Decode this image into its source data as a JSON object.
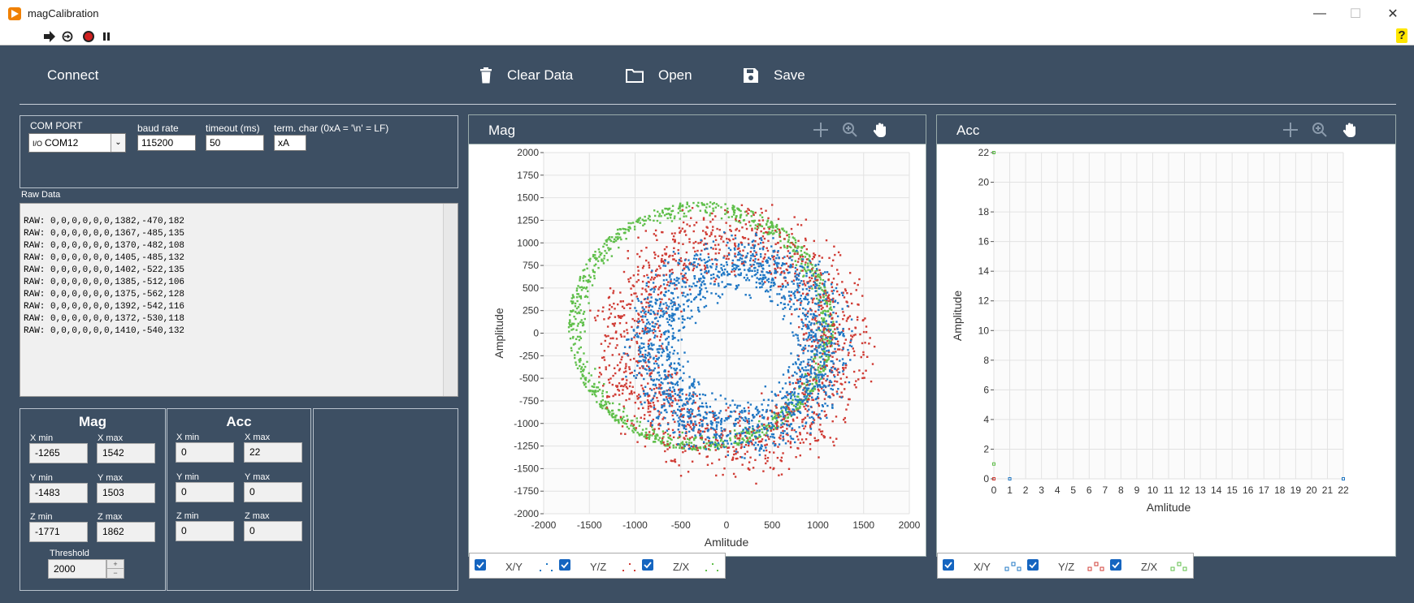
{
  "window": {
    "title": "magCalibration"
  },
  "toolbar": {
    "help_label": "?"
  },
  "top_buttons": {
    "connect": "Connect",
    "clear": "Clear Data",
    "open": "Open",
    "save": "Save"
  },
  "port": {
    "com_port_label": "COM PORT",
    "com_port_value": "COM12",
    "baud_label": "baud rate",
    "baud_value": "115200",
    "timeout_label": "timeout (ms)",
    "timeout_value": "50",
    "term_label": "term. char (0xA = '\\n' = LF)",
    "term_value": "xA"
  },
  "raw": {
    "label": "Raw Data",
    "lines": [
      "RAW: 0,0,0,0,0,0,1382,-470,182",
      "RAW: 0,0,0,0,0,0,1367,-485,135",
      "RAW: 0,0,0,0,0,0,1370,-482,108",
      "RAW: 0,0,0,0,0,0,1405,-485,132",
      "RAW: 0,0,0,0,0,0,1402,-522,135",
      "RAW: 0,0,0,0,0,0,1385,-512,106",
      "RAW: 0,0,0,0,0,0,1375,-562,128",
      "RAW: 0,0,0,0,0,0,1392,-542,116",
      "RAW: 0,0,0,0,0,0,1372,-530,118",
      "RAW: 0,0,0,0,0,0,1410,-540,132"
    ]
  },
  "mag": {
    "heading": "Mag",
    "xmin_label": "X min",
    "xmin": "-1265",
    "xmax_label": "X max",
    "xmax": "1542",
    "ymin_label": "Y min",
    "ymin": "-1483",
    "ymax_label": "Y max",
    "ymax": "1503",
    "zmin_label": "Z min",
    "zmin": "-1771",
    "zmax_label": "Z max",
    "zmax": "1862",
    "threshold_label": "Threshold",
    "threshold": "2000"
  },
  "acc": {
    "heading": "Acc",
    "xmin_label": "X min",
    "xmin": "0",
    "xmax_label": "X max",
    "xmax": "22",
    "ymin_label": "Y min",
    "ymin": "0",
    "ymax_label": "Y max",
    "ymax": "0",
    "zmin_label": "Z min",
    "zmin": "0",
    "zmax_label": "Z max",
    "zmax": "0"
  },
  "colors": {
    "xy": "#1f77c4",
    "yz": "#d03c35",
    "zx": "#5fbf4a",
    "panel": "#3d4f63"
  },
  "chart_data": [
    {
      "type": "scatter",
      "title": "Mag",
      "xlabel": "Amlitude",
      "ylabel": "Amplitude",
      "xlim": [
        -2000,
        2000
      ],
      "ylim": [
        -2000,
        2000
      ],
      "xticks": [
        -2000,
        -1500,
        -1000,
        -500,
        0,
        500,
        1000,
        1500,
        2000
      ],
      "yticks": [
        2000,
        1750,
        1500,
        1250,
        1000,
        750,
        500,
        250,
        0,
        -250,
        -500,
        -750,
        -1000,
        -1250,
        -1500,
        -1750,
        -2000
      ],
      "grid": true,
      "legend_position": "bottom-left",
      "series": [
        {
          "name": "X/Y",
          "color": "#1f77c4",
          "center": [
            130,
            -150
          ],
          "radius": [
            760,
            1300
          ]
        },
        {
          "name": "Y/Z",
          "color": "#d03c35",
          "center": [
            60,
            -100
          ],
          "radius": [
            920,
            1620
          ]
        },
        {
          "name": "Z/X",
          "color": "#5fbf4a",
          "center": [
            -280,
            80
          ],
          "radius": [
            1250,
            1450
          ]
        }
      ]
    },
    {
      "type": "scatter",
      "title": "Acc",
      "xlabel": "Amlitude",
      "ylabel": "Amplitude",
      "xlim": [
        0,
        22
      ],
      "ylim": [
        0,
        22
      ],
      "xticks": [
        0,
        1,
        2,
        3,
        4,
        5,
        6,
        7,
        8,
        9,
        10,
        11,
        12,
        13,
        14,
        15,
        16,
        17,
        18,
        19,
        20,
        21,
        22
      ],
      "yticks": [
        22,
        20,
        18,
        16,
        14,
        12,
        10,
        8,
        6,
        4,
        2,
        0
      ],
      "grid": true,
      "legend_position": "bottom-left",
      "series": [
        {
          "name": "X/Y",
          "color": "#1f77c4",
          "points": [
            [
              0,
              0
            ],
            [
              1,
              0
            ],
            [
              22,
              0
            ]
          ]
        },
        {
          "name": "Y/Z",
          "color": "#d03c35",
          "points": [
            [
              0,
              0
            ]
          ]
        },
        {
          "name": "Z/X",
          "color": "#5fbf4a",
          "points": [
            [
              0,
              22
            ],
            [
              0,
              1
            ]
          ]
        }
      ]
    }
  ],
  "legend": {
    "xy": "X/Y",
    "yz": "Y/Z",
    "zx": "Z/X"
  }
}
